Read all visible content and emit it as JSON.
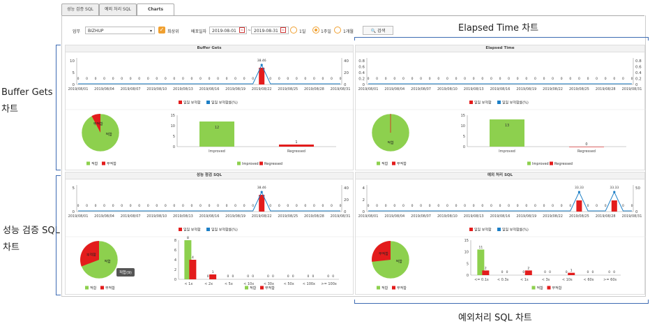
{
  "tabs": [
    "성능 검증 SQL",
    "예외 처리 SQL",
    "Charts"
  ],
  "filter": {
    "work_label": "업무",
    "work_value": "BIZHUP",
    "latest_label": "최상위",
    "deploy_label": "배포일자",
    "date_from": "2019-08-01",
    "date_sep": "~",
    "date_to": "2019-08-31",
    "periods": [
      "1일",
      "1주일",
      "1개월"
    ],
    "search_label": "검색"
  },
  "annotations": {
    "elapsed": "Elapsed Time 차트",
    "buffer_line1": "Buffer Gets",
    "buffer_line2": "차트",
    "perf_line1": "성능 검증 SQL",
    "perf_line2": "차트",
    "exception": "예외처리 SQL 차트"
  },
  "tooltip": "적합(9)",
  "colors": {
    "red": "#e31c1c",
    "green": "#8dd04e",
    "blue": "#1d7fc6",
    "bracket": "#3d6bb3"
  },
  "chart_data": [
    {
      "type": "line",
      "title": "Buffer Gets",
      "x": [
        "2019/08/01",
        "2019/08/04",
        "2019/08/07",
        "2019/08/10",
        "2019/08/13",
        "2019/08/16",
        "2019/08/19",
        "2019/08/22",
        "2019/08/25",
        "2019/08/28",
        "2019/08/31"
      ],
      "yticks": [
        "0",
        "5",
        "10"
      ],
      "y2ticks": [
        "0",
        "20",
        "40"
      ],
      "spike_label": "38.46",
      "legend": [
        "일일 부적합",
        "일일 부적합률(%)"
      ],
      "pie": {
        "labels": [
          "적합",
          "부적합"
        ],
        "values": [
          12,
          1
        ]
      },
      "bar": {
        "categories": [
          "Improved",
          "Regressed"
        ],
        "values": [
          12,
          1
        ],
        "yticks": [
          "0",
          "5",
          "10",
          "15"
        ]
      }
    },
    {
      "type": "line",
      "title": "Elapsed Time",
      "x": [
        "2019/08/01",
        "2019/08/04",
        "2019/08/07",
        "2019/08/10",
        "2019/08/13",
        "2019/08/16",
        "2019/08/19",
        "2019/08/22",
        "2019/08/25",
        "2019/08/28",
        "2019/08/31"
      ],
      "yticks": [
        "0",
        "0.2",
        "0.4",
        "0.6",
        "0.8"
      ],
      "y2ticks": [
        "0",
        "0.2",
        "0.4",
        "0.6",
        "0.8"
      ],
      "legend": [
        "일일 부적합",
        "일일 부적합률(%)"
      ],
      "pie": {
        "labels": [
          "적합",
          "부적합"
        ],
        "values": [
          13,
          0
        ]
      },
      "bar": {
        "categories": [
          "Improved",
          "Regressed"
        ],
        "values": [
          13,
          0
        ],
        "yticks": [
          "0",
          "5",
          "10",
          "15"
        ]
      }
    },
    {
      "type": "line",
      "title": "성능 점검 SQL",
      "x": [
        "2019/08/01",
        "2019/08/04",
        "2019/08/07",
        "2019/08/10",
        "2019/08/13",
        "2019/08/16",
        "2019/08/19",
        "2019/08/22",
        "2019/08/25",
        "2019/08/28",
        "2019/08/31"
      ],
      "yticks": [
        "0",
        "5"
      ],
      "y2ticks": [
        "0",
        "20",
        "40"
      ],
      "spike_label": "38.46",
      "legend": [
        "일일 부적합",
        "일일 부적합률(%)"
      ],
      "pie": {
        "labels": [
          "적합",
          "부적합"
        ],
        "values": [
          9,
          4
        ]
      },
      "bar": {
        "categories": [
          "< 1x",
          "< 2x",
          "< 5x",
          "< 10x",
          "< 30x",
          "< 50x",
          "< 100x",
          ">= 100x"
        ],
        "green": [
          8,
          0,
          0,
          0,
          0,
          0,
          0,
          0
        ],
        "red": [
          4,
          1,
          0,
          0,
          0,
          0,
          0,
          0
        ],
        "yticks": [
          "0",
          "2",
          "4",
          "6",
          "8"
        ],
        "legend": [
          "적합",
          "부적합"
        ]
      }
    },
    {
      "type": "line",
      "title": "예외 처리 SQL",
      "x": [
        "2019/08/01",
        "2019/08/04",
        "2019/08/07",
        "2019/08/10",
        "2019/08/13",
        "2019/08/16",
        "2019/08/19",
        "2019/08/22",
        "2019/08/25",
        "2019/08/28",
        "2019/08/31"
      ],
      "yticks": [
        "0",
        "2",
        "4"
      ],
      "y2ticks": [
        "0",
        "50"
      ],
      "spike_labels": [
        "33.33",
        "33.33"
      ],
      "legend": [
        "일일 부적합",
        "일일 부적합률(%)"
      ],
      "pie": {
        "labels": [
          "적합",
          "부적합"
        ],
        "values": [
          11,
          4
        ]
      },
      "bar": {
        "categories": [
          "<= 0.1s",
          "< 0.3s",
          "< 1s",
          "< 3s",
          "< 10s",
          "< 60s",
          ">= 60s"
        ],
        "green": [
          11,
          0,
          0,
          0,
          0,
          0,
          0
        ],
        "red": [
          2,
          0,
          2,
          0,
          1,
          0,
          0
        ],
        "yticks": [
          "0",
          "5",
          "10",
          "15"
        ],
        "legend": [
          "적합",
          "부적합"
        ]
      }
    }
  ]
}
